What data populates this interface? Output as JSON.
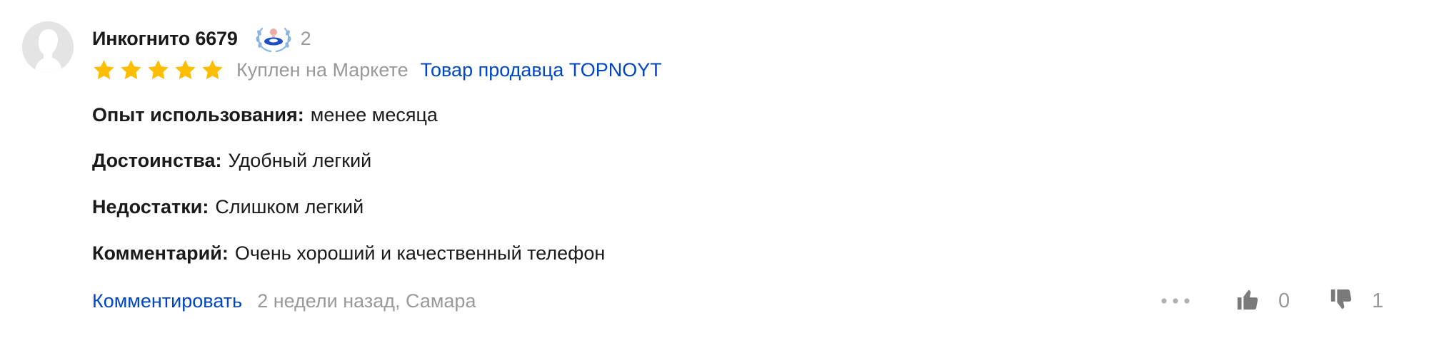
{
  "review": {
    "author": {
      "name": "Инкогнито 6679",
      "badge_icon": "pacifier-laurel-icon",
      "badge_count": "2",
      "avatar_icon": "default-avatar-icon"
    },
    "rating": {
      "stars": 5,
      "max_stars": 5,
      "star_color": "#fdbd00",
      "purchase_tag": "Куплен на Маркете",
      "seller_link": "Товар продавца TOPNOYT"
    },
    "fields": [
      {
        "label": "Опыт использования:",
        "value": "менее месяца"
      },
      {
        "label": "Достоинства:",
        "value": "Удобный легкий"
      },
      {
        "label": "Недостатки:",
        "value": "Слишком легкий"
      },
      {
        "label": "Комментарий:",
        "value": "Очень хороший и качественный телефон"
      }
    ],
    "footer": {
      "comment_link": "Комментировать",
      "meta": "2 недели назад, Самара"
    },
    "actions": {
      "more_icon": "more-dots-icon",
      "likes": "0",
      "dislikes": "1"
    },
    "colors": {
      "link": "#0046c7",
      "muted": "#999999",
      "text": "#1a1a1a"
    }
  }
}
